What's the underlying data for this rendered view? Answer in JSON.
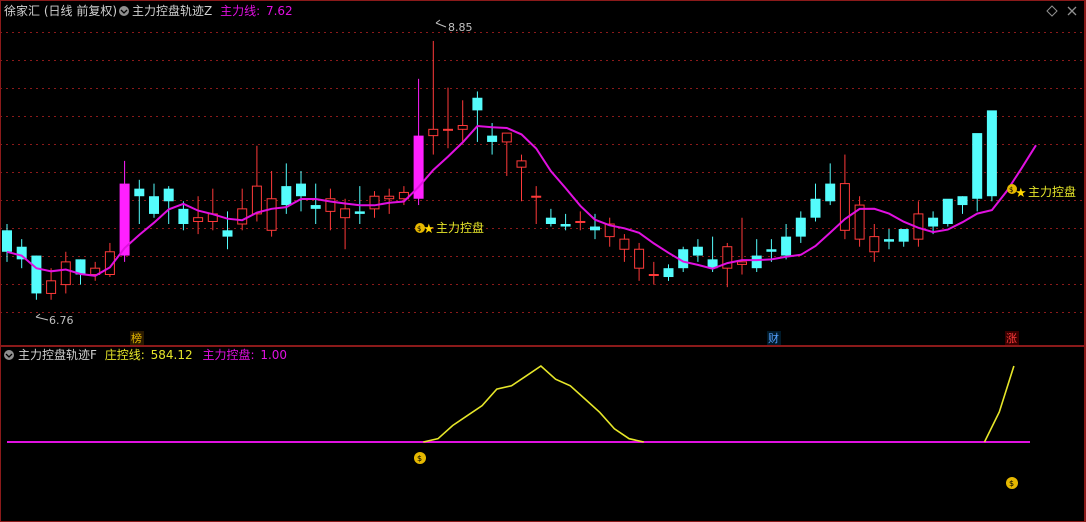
{
  "header": {
    "stock_name": "徐家汇",
    "period_info": "(日线 前复权)",
    "indicator_name": "主力控盘轨迹Z",
    "ma_label": "主力线:",
    "ma_value": "7.62"
  },
  "sub_header": {
    "indicator_name": "主力控盘轨迹F",
    "line1_label": "庄控线:",
    "line1_value": "584.12",
    "line2_label": "主力控盘:",
    "line2_value": "1.00"
  },
  "annotations": {
    "high_price": "8.85",
    "low_price": "6.76",
    "signal_text": "主力控盘",
    "markers": [
      "榜",
      "财",
      "涨"
    ]
  },
  "colors": {
    "up": "#ff3a3a",
    "down": "#54fcfc",
    "ma": "#e010e0",
    "strong_up": "#ff20ff",
    "control_line": "#e6e629",
    "baseline": "#e010e0",
    "grid": "#8b1a1a",
    "frame": "#8b1a1a",
    "marker_bang": "#e6b800",
    "marker_cai": "#54a0fc",
    "marker_zhang": "#ff3a3a"
  },
  "chart_data": [
    {
      "type": "candlestick",
      "title": "主力控盘轨迹Z",
      "ylim": [
        6.6,
        9.0
      ],
      "x": [
        0,
        1,
        2,
        3,
        4,
        5,
        6,
        7,
        8,
        9,
        10,
        11,
        12,
        13,
        14,
        15,
        16,
        17,
        18,
        19,
        20,
        21,
        22,
        23,
        24,
        25,
        26,
        27,
        28,
        29,
        30,
        31,
        32,
        33,
        34,
        35,
        36,
        37,
        38,
        39,
        40,
        41,
        42,
        43,
        44,
        45,
        46,
        47,
        48,
        49,
        50,
        51,
        52,
        53,
        54,
        55,
        56,
        57,
        58,
        59,
        60,
        61,
        62,
        63,
        64,
        65,
        66,
        67,
        68
      ],
      "open": [
        7.35,
        7.22,
        7.15,
        6.85,
        6.92,
        7.12,
        7.0,
        7.0,
        7.15,
        7.68,
        7.62,
        7.68,
        7.52,
        7.42,
        7.42,
        7.35,
        7.4,
        7.48,
        7.35,
        7.7,
        7.72,
        7.55,
        7.5,
        7.45,
        7.5,
        7.52,
        7.6,
        7.6,
        7.6,
        8.1,
        8.15,
        8.15,
        8.4,
        8.1,
        8.05,
        7.85,
        7.62,
        7.45,
        7.4,
        7.42,
        7.38,
        7.3,
        7.2,
        7.05,
        7.0,
        7.05,
        7.2,
        7.22,
        7.12,
        7.05,
        7.08,
        7.15,
        7.2,
        7.3,
        7.45,
        7.6,
        7.72,
        7.35,
        7.28,
        7.18,
        7.28,
        7.36,
        7.28,
        7.45,
        7.6,
        7.62,
        8.12,
        8.3
      ],
      "close": [
        7.18,
        7.12,
        6.85,
        6.95,
        7.1,
        7.0,
        7.05,
        7.18,
        7.72,
        7.62,
        7.48,
        7.58,
        7.4,
        7.45,
        7.48,
        7.3,
        7.52,
        7.7,
        7.6,
        7.55,
        7.62,
        7.52,
        7.6,
        7.52,
        7.48,
        7.62,
        7.62,
        7.65,
        8.1,
        8.15,
        8.15,
        8.18,
        8.3,
        8.05,
        8.12,
        7.9,
        7.62,
        7.4,
        7.38,
        7.42,
        7.35,
        7.4,
        7.28,
        7.2,
        7.0,
        6.98,
        7.05,
        7.15,
        7.05,
        7.22,
        7.1,
        7.05,
        7.18,
        7.15,
        7.3,
        7.45,
        7.58,
        7.72,
        7.55,
        7.3,
        7.26,
        7.26,
        7.48,
        7.38,
        7.4,
        7.55,
        7.6,
        7.62,
        8.12,
        8.3,
        8.48
      ],
      "high": [
        7.4,
        7.28,
        7.15,
        7.05,
        7.18,
        7.12,
        7.1,
        7.25,
        7.9,
        7.75,
        7.72,
        7.7,
        7.58,
        7.62,
        7.68,
        7.5,
        7.68,
        8.02,
        7.82,
        7.88,
        7.82,
        7.72,
        7.68,
        7.6,
        7.7,
        7.66,
        7.68,
        7.7,
        8.55,
        8.85,
        8.48,
        8.38,
        8.45,
        8.2,
        8.1,
        7.95,
        7.7,
        7.52,
        7.48,
        7.5,
        7.48,
        7.45,
        7.32,
        7.25,
        7.1,
        7.08,
        7.22,
        7.28,
        7.3,
        7.25,
        7.45,
        7.28,
        7.28,
        7.4,
        7.5,
        7.72,
        7.88,
        7.95,
        7.62,
        7.4,
        7.36,
        7.35,
        7.58,
        7.5,
        7.52,
        7.62,
        7.7,
        7.8,
        8.5,
        8.74
      ],
      "low": [
        7.1,
        7.05,
        6.8,
        6.8,
        6.85,
        6.92,
        6.95,
        6.98,
        7.1,
        7.4,
        7.45,
        7.4,
        7.35,
        7.32,
        7.35,
        7.2,
        7.35,
        7.42,
        7.3,
        7.48,
        7.5,
        7.4,
        7.35,
        7.2,
        7.4,
        7.45,
        7.48,
        7.55,
        7.55,
        7.95,
        8.0,
        8.05,
        8.05,
        7.95,
        7.78,
        7.58,
        7.4,
        7.38,
        7.35,
        7.35,
        7.28,
        7.22,
        7.1,
        6.95,
        6.92,
        6.95,
        7.02,
        7.1,
        7.02,
        6.9,
        7.0,
        7.02,
        7.1,
        7.12,
        7.25,
        7.42,
        7.55,
        7.28,
        7.22,
        7.1,
        7.2,
        7.22,
        7.22,
        7.32,
        7.38,
        7.48,
        7.5,
        7.58,
        7.9,
        8.05
      ]
    },
    {
      "type": "line",
      "title": "主力控盘轨迹F",
      "ylim": [
        0,
        600
      ],
      "series": [
        {
          "name": "庄控线",
          "x_start": 29,
          "values": [
            0,
            10,
            50,
            80,
            110,
            160,
            170,
            200,
            230,
            190,
            170,
            130,
            90,
            40,
            10,
            0
          ]
        },
        {
          "name": "主力控盘",
          "x_start": 0,
          "values_const": 1.0
        }
      ]
    }
  ]
}
